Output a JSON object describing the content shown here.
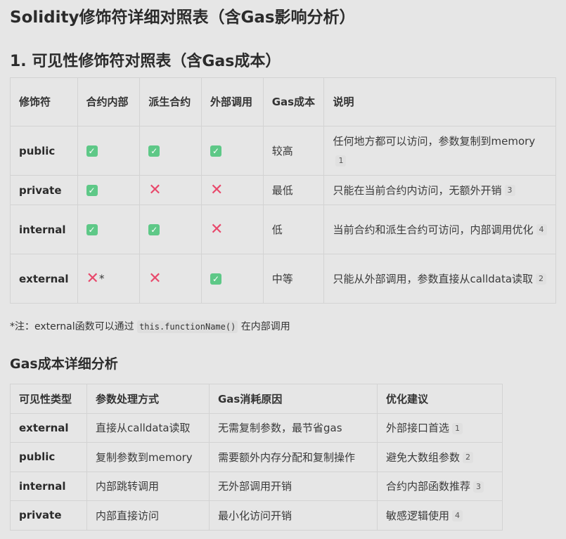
{
  "title": "Solidity修饰符详细对照表（含Gas影响分析）",
  "section1": {
    "heading": "1. 可见性修饰符对照表（含Gas成本）",
    "headers": {
      "modifier": "修饰符",
      "contract_internal": "合约内部",
      "derived": "派生合约",
      "external_call": "外部调用",
      "gas_cost": "Gas成本",
      "description": "说明"
    },
    "rows": [
      {
        "modifier": "public",
        "contract_internal": "yes",
        "derived": "yes",
        "external_call": "yes",
        "gas_cost": "较高",
        "description": "任何地方都可以访问，参数复制到memory",
        "ref": "1"
      },
      {
        "modifier": "private",
        "contract_internal": "yes",
        "derived": "no",
        "external_call": "no",
        "gas_cost": "最低",
        "description": "只能在当前合约内访问，无额外开销",
        "ref": "3"
      },
      {
        "modifier": "internal",
        "contract_internal": "yes",
        "derived": "yes",
        "external_call": "no",
        "gas_cost": "低",
        "description": "当前合约和派生合约可访问，内部调用优化",
        "ref": "4"
      },
      {
        "modifier": "external",
        "contract_internal": "no",
        "contract_internal_mark": "*",
        "derived": "no",
        "external_call": "yes",
        "gas_cost": "中等",
        "description": "只能从外部调用，参数直接从calldata读取",
        "ref": "2"
      }
    ],
    "note_prefix": "*注：external函数可以通过",
    "note_code": "this.functionName()",
    "note_suffix": "在内部调用"
  },
  "section2": {
    "heading": "Gas成本详细分析",
    "headers": {
      "type": "可见性类型",
      "param": "参数处理方式",
      "reason": "Gas消耗原因",
      "advice": "优化建议"
    },
    "rows": [
      {
        "type": "external",
        "param": "直接从calldata读取",
        "reason": "无需复制参数，最节省gas",
        "advice": "外部接口首选",
        "ref": "1"
      },
      {
        "type": "public",
        "param": "复制参数到memory",
        "reason": "需要额外内存分配和复制操作",
        "advice": "避免大数组参数",
        "ref": "2"
      },
      {
        "type": "internal",
        "param": "内部跳转调用",
        "reason": "无外部调用开销",
        "advice": "合约内部函数推荐",
        "ref": "3"
      },
      {
        "type": "private",
        "param": "内部直接访问",
        "reason": "最小化访问开销",
        "advice": "敏感逻辑使用",
        "ref": "4"
      }
    ]
  },
  "icons": {
    "yes": "check-mark-icon",
    "no": "cross-mark-icon"
  },
  "colors": {
    "check": "#5ec887",
    "cross": "#e8486b",
    "background": "#e6e6e6"
  }
}
